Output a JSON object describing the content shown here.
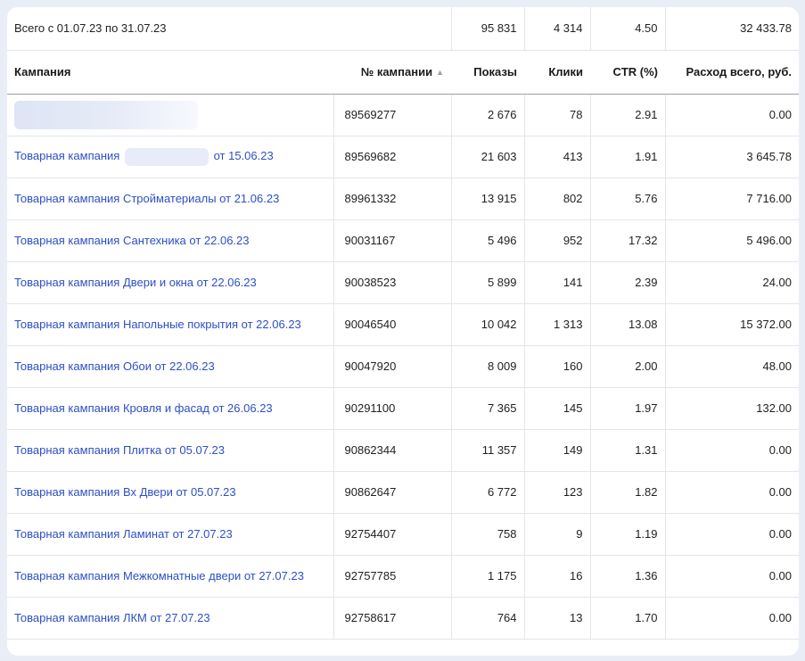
{
  "summary": {
    "label": "Всего с 01.07.23 по 31.07.23",
    "impressions": "95 831",
    "clicks": "4 314",
    "ctr": "4.50",
    "cost": "32 433.78"
  },
  "columns": {
    "campaign": "Кампания",
    "campaign_id": "№ кампании",
    "sort_indicator": "▲",
    "impressions": "Показы",
    "clicks": "Клики",
    "ctr": "CTR (%)",
    "cost": "Расход всего, руб."
  },
  "rows": [
    {
      "name": "",
      "name_prefix": "",
      "name_suffix": "",
      "id": "89569277",
      "impressions": "2 676",
      "clicks": "78",
      "ctr": "2.91",
      "cost": "0.00"
    },
    {
      "name": "",
      "name_prefix": "Товарная кампания",
      "name_suffix": "от 15.06.23",
      "id": "89569682",
      "impressions": "21 603",
      "clicks": "413",
      "ctr": "1.91",
      "cost": "3 645.78"
    },
    {
      "name": "Товарная кампания Стройматериалы от 21.06.23",
      "id": "89961332",
      "impressions": "13 915",
      "clicks": "802",
      "ctr": "5.76",
      "cost": "7 716.00"
    },
    {
      "name": "Товарная кампания Сантехника от 22.06.23",
      "id": "90031167",
      "impressions": "5 496",
      "clicks": "952",
      "ctr": "17.32",
      "cost": "5 496.00"
    },
    {
      "name": "Товарная кампания Двери и окна от 22.06.23",
      "id": "90038523",
      "impressions": "5 899",
      "clicks": "141",
      "ctr": "2.39",
      "cost": "24.00"
    },
    {
      "name": "Товарная кампания Напольные покрытия от 22.06.23",
      "id": "90046540",
      "impressions": "10 042",
      "clicks": "1 313",
      "ctr": "13.08",
      "cost": "15 372.00"
    },
    {
      "name": "Товарная кампания Обои от 22.06.23",
      "id": "90047920",
      "impressions": "8 009",
      "clicks": "160",
      "ctr": "2.00",
      "cost": "48.00"
    },
    {
      "name": "Товарная кампания Кровля и фасад от 26.06.23",
      "id": "90291100",
      "impressions": "7 365",
      "clicks": "145",
      "ctr": "1.97",
      "cost": "132.00"
    },
    {
      "name": "Товарная кампания Плитка от 05.07.23",
      "id": "90862344",
      "impressions": "11 357",
      "clicks": "149",
      "ctr": "1.31",
      "cost": "0.00"
    },
    {
      "name": "Товарная кампания Вх Двери от 05.07.23",
      "id": "90862647",
      "impressions": "6 772",
      "clicks": "123",
      "ctr": "1.82",
      "cost": "0.00"
    },
    {
      "name": "Товарная кампания Ламинат от 27.07.23",
      "id": "92754407",
      "impressions": "758",
      "clicks": "9",
      "ctr": "1.19",
      "cost": "0.00"
    },
    {
      "name": "Товарная кампания Межкомнатные двери от 27.07.23",
      "id": "92757785",
      "impressions": "1 175",
      "clicks": "16",
      "ctr": "1.36",
      "cost": "0.00"
    },
    {
      "name": "Товарная кампания ЛКМ от 27.07.23",
      "id": "92758617",
      "impressions": "764",
      "clicks": "13",
      "ctr": "1.70",
      "cost": "0.00"
    }
  ],
  "colors": {
    "link": "#2c4fc6",
    "page_background": "#e9eef6",
    "card_background": "#ffffff",
    "border": "#e3e5e8"
  }
}
